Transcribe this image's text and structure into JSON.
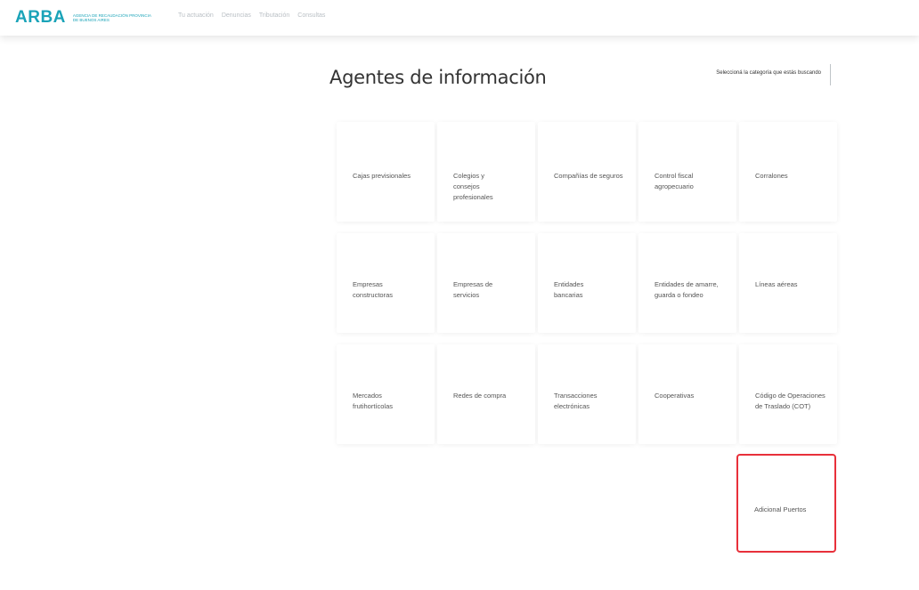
{
  "header": {
    "logo": "ARBA",
    "logo_subtitle": "Agencia de Recaudación Provincia de Buenos Aires",
    "nav": [
      "Tu actuación",
      "Denuncias",
      "Tributación",
      "Consultas"
    ]
  },
  "page": {
    "title": "Agentes de información",
    "category_select_label": "Seleccioná la categoría que estás buscando"
  },
  "cards": [
    {
      "label": "Cajas previsionales"
    },
    {
      "label": "Colegios y consejos profesionales"
    },
    {
      "label": "Compañías de seguros"
    },
    {
      "label": "Control fiscal agropecuario"
    },
    {
      "label": "Corralones"
    },
    {
      "label": "Empresas constructoras"
    },
    {
      "label": "Empresas de servicios"
    },
    {
      "label": "Entidades bancarias"
    },
    {
      "label": "Entidades de amarre, guarda o fondeo"
    },
    {
      "label": "Líneas aéreas"
    },
    {
      "label": "Mercados frutihortícolas"
    },
    {
      "label": "Redes de compra"
    },
    {
      "label": "Transacciones electrónicas"
    },
    {
      "label": "Cooperativas"
    },
    {
      "label": "Código de Operaciones de Traslado (COT)"
    },
    {
      "label": "Adicional Puertos"
    }
  ]
}
